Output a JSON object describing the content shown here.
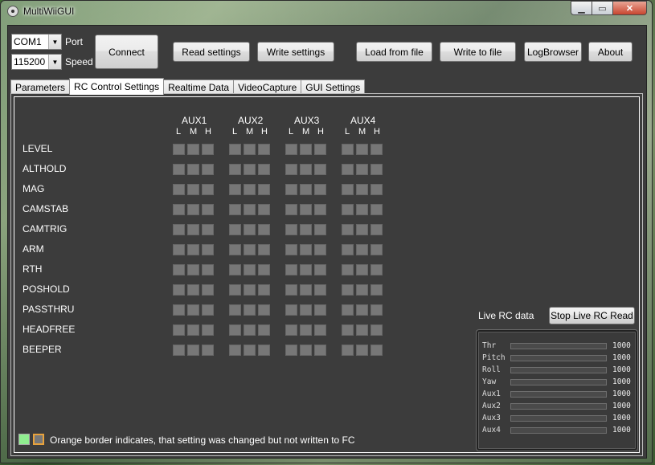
{
  "window": {
    "title": "MultiWiiGUI",
    "minimize": "▁",
    "maximize": "▭",
    "close": "✕"
  },
  "connection": {
    "port_value": "COM1",
    "port_label": "Port",
    "speed_value": "115200",
    "speed_label": "Speed",
    "connect_label": "Connect"
  },
  "toolbar": {
    "read_settings": "Read settings",
    "write_settings": "Write settings",
    "load_from_file": "Load from file",
    "write_to_file": "Write to file",
    "log_browser": "LogBrowser",
    "about": "About"
  },
  "tabs": [
    "Parameters",
    "RC Control Settings",
    "Realtime Data",
    "VideoCapture",
    "GUI Settings"
  ],
  "active_tab": "RC Control Settings",
  "aux_headers": [
    "AUX1",
    "AUX2",
    "AUX3",
    "AUX4"
  ],
  "level_labels": [
    "L",
    "M",
    "H"
  ],
  "modes": [
    "LEVEL",
    "ALTHOLD",
    "MAG",
    "CAMSTAB",
    "CAMTRIG",
    "ARM",
    "RTH",
    "POSHOLD",
    "PASSTHRU",
    "HEADFREE",
    "BEEPER"
  ],
  "live_rc": {
    "label": "Live RC data",
    "stop_button": "Stop Live RC Read",
    "channels": [
      {
        "name": "Thr",
        "value": "1000"
      },
      {
        "name": "Pitch",
        "value": "1000"
      },
      {
        "name": "Roll",
        "value": "1000"
      },
      {
        "name": "Yaw",
        "value": "1000"
      },
      {
        "name": "Aux1",
        "value": "1000"
      },
      {
        "name": "Aux2",
        "value": "1000"
      },
      {
        "name": "Aux3",
        "value": "1000"
      },
      {
        "name": "Aux4",
        "value": "1000"
      }
    ]
  },
  "legend": {
    "text": "Orange border indicates, that setting was changed but not written to FC",
    "active_color": "#90ee90",
    "changed_border_color": "#e8a23c"
  }
}
